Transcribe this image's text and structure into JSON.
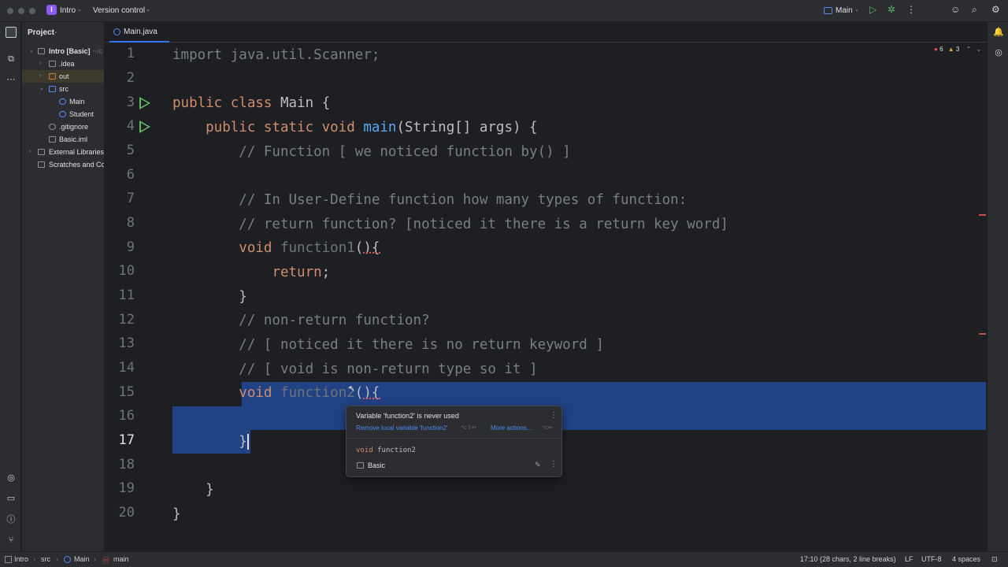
{
  "titlebar": {
    "project_badge": "I",
    "project_name": "Intro",
    "vcs": "Version control",
    "run_config": "Main"
  },
  "sidebar": {
    "title": "Project",
    "tree": [
      {
        "label": "Intro [Basic]",
        "suffix": "~/c"
      },
      {
        "label": ".idea"
      },
      {
        "label": "out"
      },
      {
        "label": "src"
      },
      {
        "label": "Main"
      },
      {
        "label": "Student"
      },
      {
        "label": ".gitignore"
      },
      {
        "label": "Basic.iml"
      },
      {
        "label": "External Libraries"
      },
      {
        "label": "Scratches and Co"
      }
    ]
  },
  "editor": {
    "tab": "Main.java",
    "inspections": {
      "errors": "6",
      "warnings": "3"
    },
    "line_numbers": [
      "1",
      "2",
      "3",
      "4",
      "5",
      "6",
      "7",
      "8",
      "9",
      "10",
      "11",
      "12",
      "13",
      "14",
      "15",
      "16",
      "17",
      "18",
      "19",
      "20"
    ],
    "lines": {
      "l1": "import java.util.Scanner;",
      "l3a": "public class ",
      "l3b": "Main {",
      "l4a": "    public static void ",
      "l4b": "main",
      "l4c": "(String[] args) {",
      "l5": "        // Function [ we noticed function by() ]",
      "l7": "        // In User-Define function how many types of function:",
      "l8": "        // return function? [noticed it there is a return key word]",
      "l9a": "        void ",
      "l9b": "function1",
      "l9c": "(){",
      "l10a": "            ",
      "l10b": "return",
      "l10c": ";",
      "l11": "        }",
      "l12": "        // non-return function?",
      "l13": "        // [ noticed it there is no return keyword ]",
      "l14": "        // [ void is non-return type so it ]",
      "l15a": "        void ",
      "l15b": "function2",
      "l15c": "(){",
      "l17": "        }",
      "l19": "    }",
      "l20": "}"
    }
  },
  "popup": {
    "message": "Variable 'function2' is never used",
    "action1": "Remove local variable 'function2'",
    "action1_shortcut": "⌥⇧↩",
    "action2": "More actions...",
    "action2_shortcut": "⌥↩",
    "signature_kw": "void",
    "signature_name": "function2",
    "module": "Basic"
  },
  "statusbar": {
    "crumbs": [
      "Intro",
      "src",
      "Main",
      "main"
    ],
    "position": "17:10 (28 chars, 2 line breaks)",
    "line_sep": "LF",
    "encoding": "UTF-8",
    "indent": "4 spaces"
  }
}
